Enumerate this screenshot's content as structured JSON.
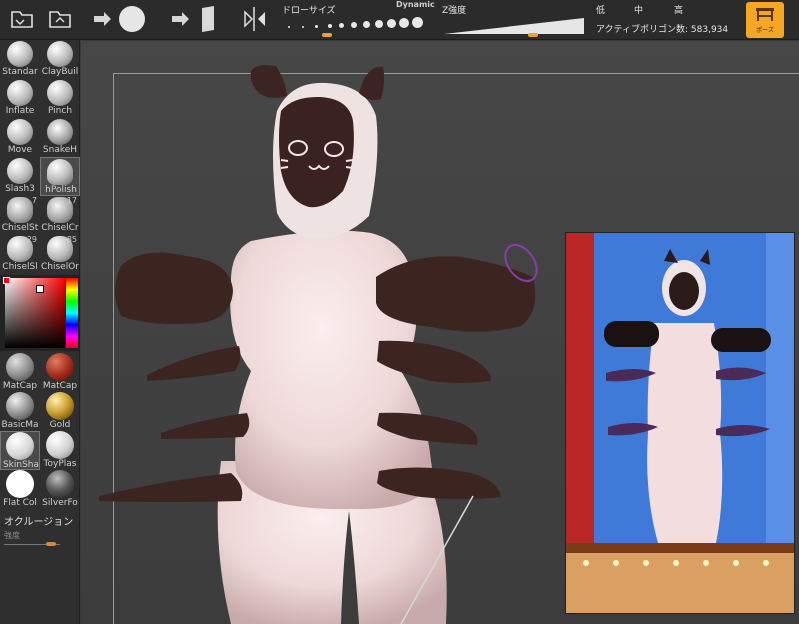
{
  "toolbar": {
    "draw_size_label": "ドローサイズ",
    "dynamic_label": "Dynamic",
    "z_intensity_label": "Z強度",
    "low_label": "低",
    "mid_label": "中",
    "high_label": "高",
    "active_polygons_label": "アクティブポリゴン数: 583,934",
    "pose_label": "ポーズ"
  },
  "brushes": [
    {
      "name": "Standar"
    },
    {
      "name": "ClayBuil"
    },
    {
      "name": "Inflate"
    },
    {
      "name": "Pinch"
    },
    {
      "name": "Move"
    },
    {
      "name": "SnakeH"
    },
    {
      "name": "Slash3"
    },
    {
      "name": "hPolish"
    },
    {
      "name": "ChiselSt",
      "num": "7"
    },
    {
      "name": "ChiselCr",
      "num": "17"
    },
    {
      "name": "ChiselSl",
      "num": "29"
    },
    {
      "name": "ChiselOr",
      "num": "85"
    }
  ],
  "materials": [
    {
      "name": "MatCap"
    },
    {
      "name": "MatCap"
    },
    {
      "name": "BasicMa"
    },
    {
      "name": "Gold"
    },
    {
      "name": "SkinSha"
    },
    {
      "name": "ToyPlas"
    },
    {
      "name": "Flat Col"
    },
    {
      "name": "SilverFo"
    }
  ],
  "occlusion": {
    "label": "オクルージョン",
    "intensity_label": "強度"
  },
  "colors": {
    "accent": "#f5a623",
    "skin": "#f1dcdc",
    "dark_brown": "#3c2421"
  }
}
